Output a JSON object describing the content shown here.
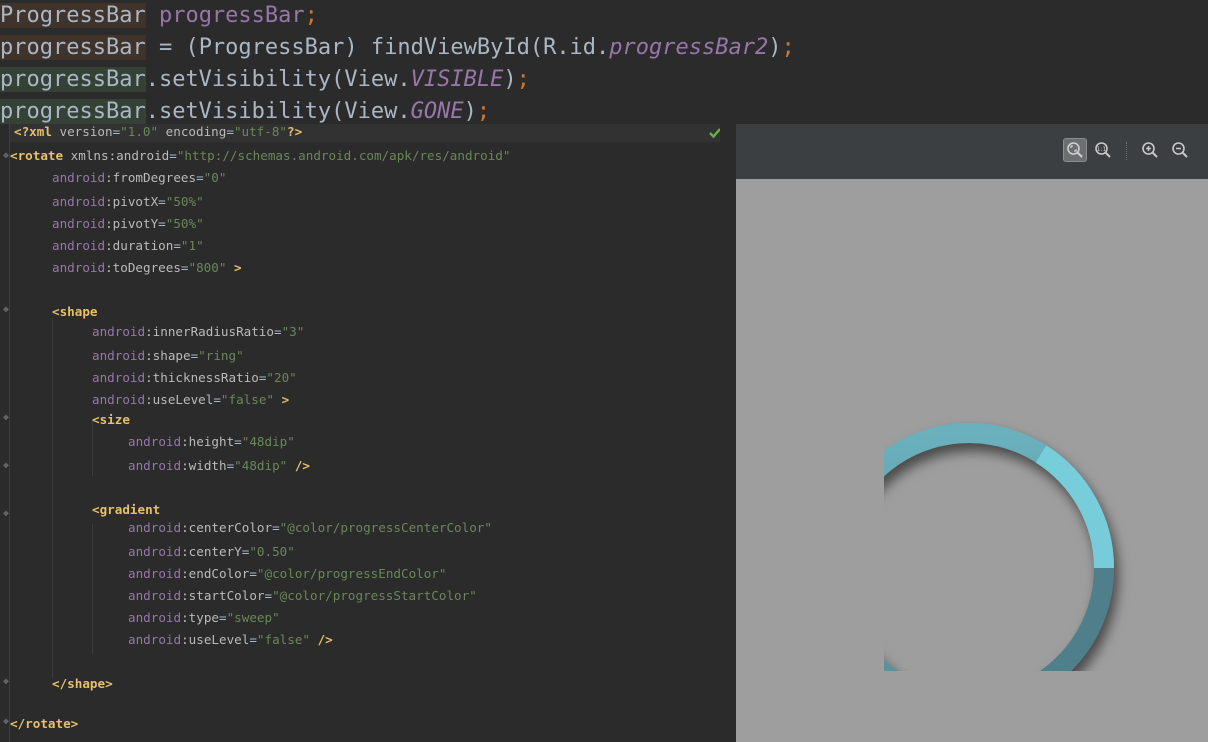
{
  "java_snippet": {
    "line1": {
      "type": "ProgressBar",
      "space": " ",
      "field": "progressBar",
      "semi": ";"
    },
    "line2": {
      "var": "progressBar",
      "eq": " = (",
      "cast": "ProgressBar",
      "call": ") findViewById(R.id.",
      "id": "progressBar2",
      "close": ")",
      "semi": ";"
    },
    "line3": {
      "var": "progressBar",
      "call": ".setVisibility(View.",
      "const": "VISIBLE",
      "close": ")",
      "semi": ";"
    },
    "line4": {
      "var": "progressBar",
      "call": ".setVisibility(View.",
      "const": "GONE",
      "close": ")",
      "semi": ";"
    }
  },
  "xml": {
    "decl": {
      "open": "<?xml ",
      "a1": "version",
      "eq1": "=",
      "v1": "\"1.0\"",
      "a2": " encoding",
      "eq2": "=",
      "v2": "\"utf-8\"",
      "close": "?>"
    },
    "rotate_open": {
      "tag": "<rotate ",
      "ns": "xmlns:android",
      "eq": "=",
      "val": "\"http://schemas.android.com/apk/res/android\""
    },
    "rotate_attrs": [
      {
        "ns": "android",
        "name": ":fromDegrees",
        "eq": "=",
        "val": "\"0\""
      },
      {
        "ns": "android",
        "name": ":pivotX",
        "eq": "=",
        "val": "\"50%\""
      },
      {
        "ns": "android",
        "name": ":pivotY",
        "eq": "=",
        "val": "\"50%\""
      },
      {
        "ns": "android",
        "name": ":duration",
        "eq": "=",
        "val": "\"1\""
      },
      {
        "ns": "android",
        "name": ":toDegrees",
        "eq": "=",
        "val": "\"800\"",
        "end": " >"
      }
    ],
    "shape_open": "<shape",
    "shape_attrs": [
      {
        "ns": "android",
        "name": ":innerRadiusRatio",
        "eq": "=",
        "val": "\"3\""
      },
      {
        "ns": "android",
        "name": ":shape",
        "eq": "=",
        "val": "\"ring\""
      },
      {
        "ns": "android",
        "name": ":thicknessRatio",
        "eq": "=",
        "val": "\"20\""
      },
      {
        "ns": "android",
        "name": ":useLevel",
        "eq": "=",
        "val": "\"false\"",
        "end": " >"
      }
    ],
    "size_open": "<size",
    "size_attrs": [
      {
        "ns": "android",
        "name": ":height",
        "eq": "=",
        "val": "\"48dip\""
      },
      {
        "ns": "android",
        "name": ":width",
        "eq": "=",
        "val": "\"48dip\"",
        "end": " />"
      }
    ],
    "gradient_open": "<gradient",
    "gradient_attrs": [
      {
        "ns": "android",
        "name": ":centerColor",
        "eq": "=",
        "val": "\"@color/progressCenterColor\""
      },
      {
        "ns": "android",
        "name": ":centerY",
        "eq": "=",
        "val": "\"0.50\""
      },
      {
        "ns": "android",
        "name": ":endColor",
        "eq": "=",
        "val": "\"@color/progressEndColor\""
      },
      {
        "ns": "android",
        "name": ":startColor",
        "eq": "=",
        "val": "\"@color/progressStartColor\""
      },
      {
        "ns": "android",
        "name": ":type",
        "eq": "=",
        "val": "\"sweep\""
      },
      {
        "ns": "android",
        "name": ":useLevel",
        "eq": "=",
        "val": "\"false\"",
        "end": " />"
      }
    ],
    "shape_close": "</shape>",
    "rotate_close": "</rotate>"
  },
  "preview": {
    "toolbar_icons": [
      "zoom-to-fit-icon",
      "actual-size-icon",
      "zoom-in-icon",
      "zoom-out-icon"
    ],
    "ring_colors": {
      "start": "#4f7f8a",
      "center": "#5f9bab",
      "end": "#79cfdc"
    }
  },
  "colors": {
    "editor_bg": "#2b2b2b",
    "xml_tag": "#e8bf6a",
    "xml_value": "#6a8759",
    "xml_namespace": "#9876aa",
    "java_keyword": "#cc7832",
    "preview_bg": "#9e9e9e"
  }
}
